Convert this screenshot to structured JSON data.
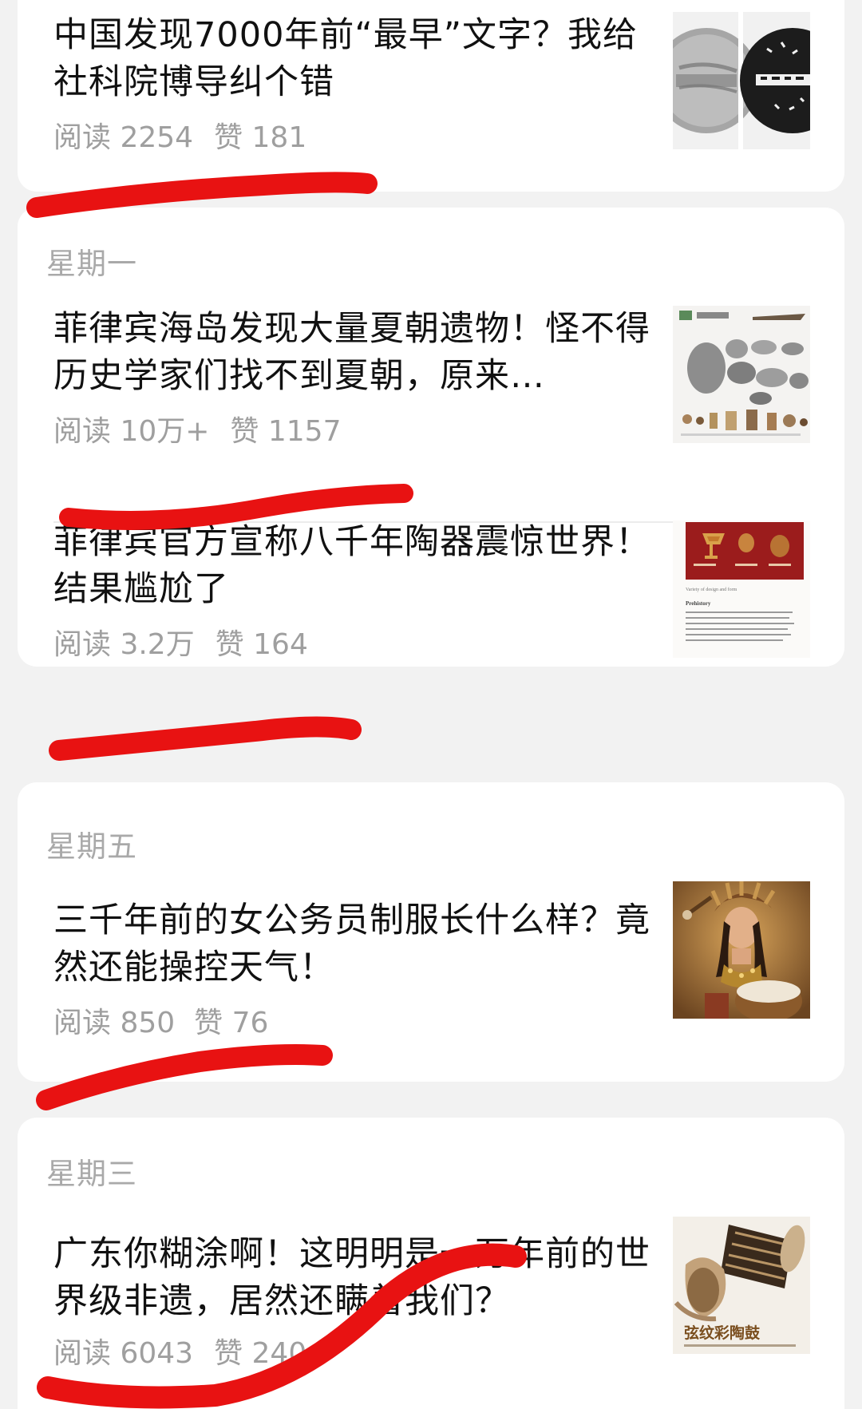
{
  "articles": [
    {
      "title": "中国发现7000年前“最早”文字？我给社科院博导纠个错",
      "reads": "阅读 2254",
      "likes": "赞 181",
      "thumb_icon": "inscribed-disc-image"
    },
    {
      "title": "菲律宾海岛发现大量夏朝遗物！怪不得历史学家们找不到夏朝，原来…",
      "reads": "阅读 10万+",
      "likes": "赞 1157",
      "thumb_icon": "pottery-collection-image"
    },
    {
      "title": "菲律宾官方宣称八千年陶器震惊世界！结果尴尬了",
      "reads": "阅读 3.2万",
      "likes": "赞 164",
      "thumb_icon": "pottery-document-image"
    },
    {
      "title": "三千年前的女公务员制服长什么样？竟然还能操控天气！",
      "reads": "阅读 850",
      "likes": "赞 76",
      "thumb_icon": "drummer-portrait-image"
    },
    {
      "title": "广东你糊涂啊！这明明是一万年前的世界级非遗，居然还瞒着我们？",
      "reads": "阅读 6043",
      "likes": "赞 240",
      "thumb_icon": "painted-pottery-drum-image",
      "thumb_caption": "弦纹彩陶鼓"
    }
  ],
  "days": {
    "monday": "星期一",
    "friday": "星期五",
    "wednesday": "星期三"
  },
  "thumb_texts": {
    "article3_heading": "Prehistory",
    "article3_subtitle": "Variety of design and form"
  },
  "colors": {
    "page_bg": "#f2f2f2",
    "card_bg": "#ffffff",
    "title": "#111111",
    "meta": "#9f9f9f",
    "day": "#a9a9a9",
    "red_mark": "#e81212"
  }
}
